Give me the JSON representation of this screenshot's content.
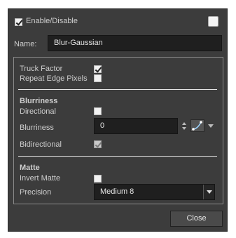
{
  "header": {
    "enable_label": "Enable/Disable",
    "enable_checked": true,
    "color_swatch_checked": false
  },
  "name": {
    "label": "Name:",
    "value": "Blur-Gaussian"
  },
  "options": {
    "truck_factor_label": "Truck Factor",
    "truck_factor_checked": true,
    "repeat_edge_label": "Repeat Edge Pixels",
    "repeat_edge_checked": false
  },
  "blurriness_section": {
    "title": "Blurriness",
    "directional_label": "Directional",
    "directional_checked": false,
    "blurriness_label": "Blurriness",
    "blurriness_value": "0",
    "bidirectional_label": "Bidirectional",
    "bidirectional_checked": true,
    "bidirectional_enabled": false
  },
  "matte_section": {
    "title": "Matte",
    "invert_matte_label": "Invert Matte",
    "invert_matte_checked": false,
    "precision_label": "Precision",
    "precision_value": "Medium 8"
  },
  "footer": {
    "close_label": "Close"
  }
}
